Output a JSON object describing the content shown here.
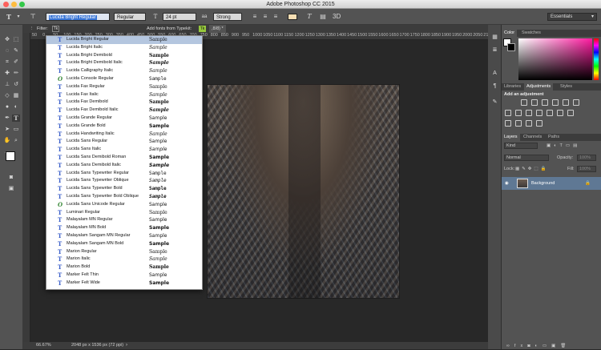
{
  "app": {
    "title": "Adobe Photoshop CC 2015"
  },
  "options_bar": {
    "font_family": "Lucida Bright Regular",
    "font_style": "Regular",
    "font_size": "24 pt",
    "antialias": "Strong",
    "aa_icon_text": "aa",
    "workspace": "Essentials",
    "text_color": "#f5deb3"
  },
  "font_filter": {
    "label": "Filter:",
    "typekit_label": "Add fonts from Typekit:",
    "doc_tab_fragment": ",8/8) *"
  },
  "fonts": [
    {
      "name": "Lucida Bright Regular",
      "sample": "Sample",
      "icon": "T",
      "selected": true
    },
    {
      "name": "Lucida Bright Italic",
      "sample": "Sample",
      "icon": "T"
    },
    {
      "name": "Lucida Bright Demibold",
      "sample": "Sample",
      "icon": "T"
    },
    {
      "name": "Lucida Bright Demibold Italic",
      "sample": "Sample",
      "icon": "T"
    },
    {
      "name": "Lucida Calligraphy Italic",
      "sample": "Sample",
      "icon": "T"
    },
    {
      "name": "Lucida Console Regular",
      "sample": "Sample",
      "icon": "O"
    },
    {
      "name": "Lucida Fax Regular",
      "sample": "Sample",
      "icon": "T"
    },
    {
      "name": "Lucida Fax Italic",
      "sample": "Sample",
      "icon": "T"
    },
    {
      "name": "Lucida Fax Demibold",
      "sample": "Sample",
      "icon": "T"
    },
    {
      "name": "Lucida Fax Demibold Italic",
      "sample": "Sample",
      "icon": "T"
    },
    {
      "name": "Lucida Grande Regular",
      "sample": "Sample",
      "icon": "T"
    },
    {
      "name": "Lucida Grande Bold",
      "sample": "Sample",
      "icon": "T"
    },
    {
      "name": "Lucida Handwriting Italic",
      "sample": "Sample",
      "icon": "T"
    },
    {
      "name": "Lucida Sans Regular",
      "sample": "Sample",
      "icon": "T"
    },
    {
      "name": "Lucida Sans Italic",
      "sample": "Sample",
      "icon": "T"
    },
    {
      "name": "Lucida Sans Demibold Roman",
      "sample": "Sample",
      "icon": "T"
    },
    {
      "name": "Lucida Sans Demibold Italic",
      "sample": "Sample",
      "icon": "T"
    },
    {
      "name": "Lucida Sans Typewriter Regular",
      "sample": "Sample",
      "icon": "T"
    },
    {
      "name": "Lucida Sans Typewriter Oblique",
      "sample": "Sample",
      "icon": "T"
    },
    {
      "name": "Lucida Sans Typewriter Bold",
      "sample": "Sample",
      "icon": "T"
    },
    {
      "name": "Lucida Sans Typewriter Bold Oblique",
      "sample": "Sample",
      "icon": "T"
    },
    {
      "name": "Lucida Sans Unicode Regular",
      "sample": "Sample",
      "icon": "O"
    },
    {
      "name": "Luminari Regular",
      "sample": "Sample",
      "icon": "T"
    },
    {
      "name": "Malayalam MN Regular",
      "sample": "Sample",
      "icon": "T"
    },
    {
      "name": "Malayalam MN Bold",
      "sample": "Sample",
      "icon": "T"
    },
    {
      "name": "Malayalam Sangam MN Regular",
      "sample": "Sample",
      "icon": "T"
    },
    {
      "name": "Malayalam Sangam MN Bold",
      "sample": "Sample",
      "icon": "T"
    },
    {
      "name": "Marion Regular",
      "sample": "Sample",
      "icon": "T"
    },
    {
      "name": "Marion Italic",
      "sample": "Sample",
      "icon": "T"
    },
    {
      "name": "Marion Bold",
      "sample": "Sample",
      "icon": "T"
    },
    {
      "name": "Marker Felt Thin",
      "sample": "Sample",
      "icon": "T"
    },
    {
      "name": "Marker Felt Wide",
      "sample": "Sample",
      "icon": "T"
    }
  ],
  "ruler": {
    "ticks": [
      "50",
      "0",
      "50",
      "100",
      "150",
      "200",
      "250",
      "300",
      "350",
      "400",
      "450",
      "500",
      "550",
      "600",
      "650",
      "700",
      "750",
      "800",
      "850",
      "900",
      "950",
      "1000",
      "1050",
      "1100",
      "1150",
      "1200",
      "1250",
      "1300",
      "1350",
      "1400",
      "1450",
      "1500",
      "1550",
      "1600",
      "1650",
      "1700",
      "1750",
      "1800",
      "1850",
      "1900",
      "1950",
      "2000",
      "2050",
      "2100"
    ]
  },
  "status": {
    "zoom": "66.67%",
    "doc_info": "2048 px x 1536 px (72 ppi)"
  },
  "panels": {
    "color_tabs": [
      "Color",
      "Swatches"
    ],
    "adjust_tabs": [
      "Libraries",
      "Adjustments",
      "Styles"
    ],
    "adjust_title": "Add an adjustment",
    "layer_tabs": [
      "Layers",
      "Channels",
      "Paths"
    ],
    "kind_label": "Kind",
    "blend_mode": "Normal",
    "opacity_label": "Opacity:",
    "opacity_value": "100%",
    "lock_label": "Lock:",
    "fill_label": "Fill:",
    "fill_value": "100%",
    "layer_name": "Background"
  }
}
